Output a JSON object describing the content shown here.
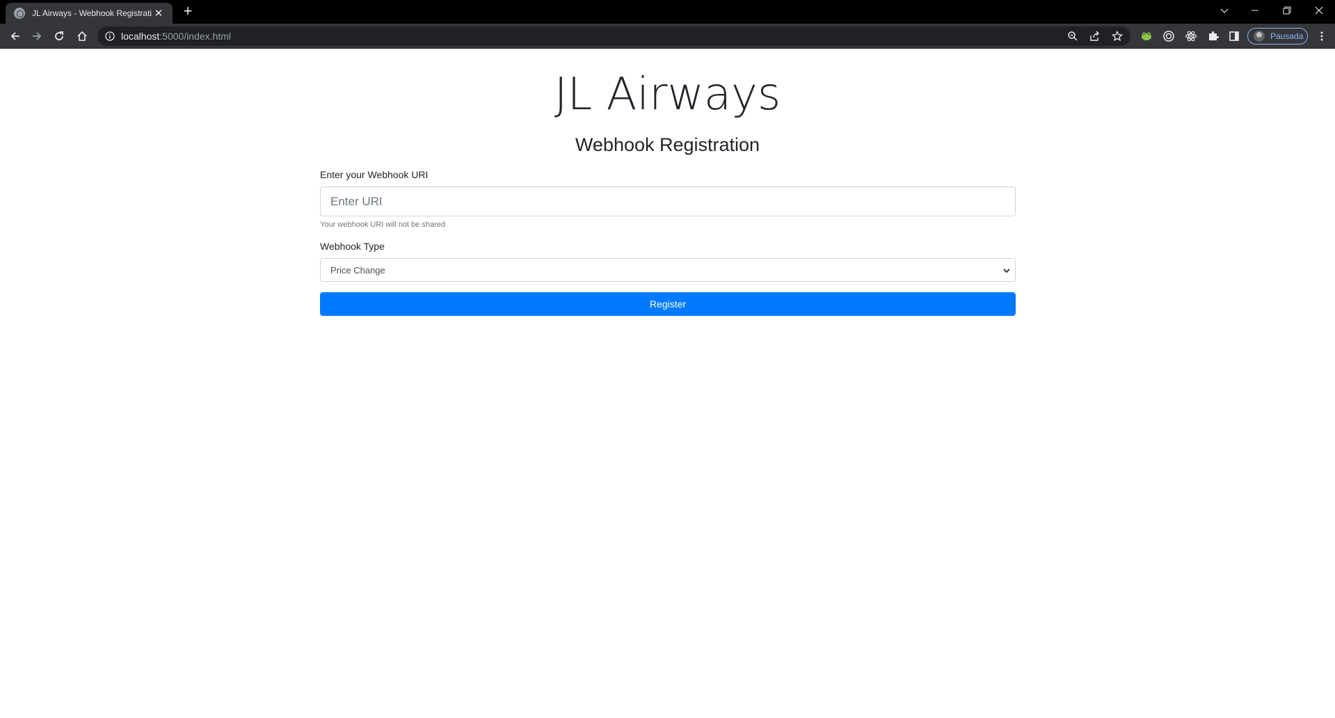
{
  "browser": {
    "tab_title": "JL Airways - Webhook Registration",
    "url_host": "localhost",
    "url_rest": ":5000/index.html",
    "profile_label": "Pausada"
  },
  "page": {
    "brand": "JL Airways",
    "subtitle": "Webhook Registration",
    "uri_label": "Enter your Webhook URI",
    "uri_placeholder": "Enter URI",
    "uri_value": "",
    "uri_help": "Your webhook URI will not be shared",
    "type_label": "Webhook Type",
    "type_selected": "Price Change",
    "register_label": "Register"
  },
  "colors": {
    "primary": "#007bff",
    "tabbar": "#000000",
    "toolbar": "#35363a",
    "omnibox": "#202124",
    "text": "#212529"
  },
  "icons": [
    "globe-icon",
    "close-icon",
    "plus-icon",
    "chevron-down-icon",
    "minimize-icon",
    "restore-icon",
    "close-window-icon",
    "back-icon",
    "forward-icon",
    "reload-icon",
    "home-icon",
    "info-icon",
    "zoom-icon",
    "share-icon",
    "star-icon",
    "frog-extension-icon",
    "target-extension-icon",
    "react-extension-icon",
    "puzzle-icon",
    "sidepanel-icon",
    "menu-icon"
  ]
}
